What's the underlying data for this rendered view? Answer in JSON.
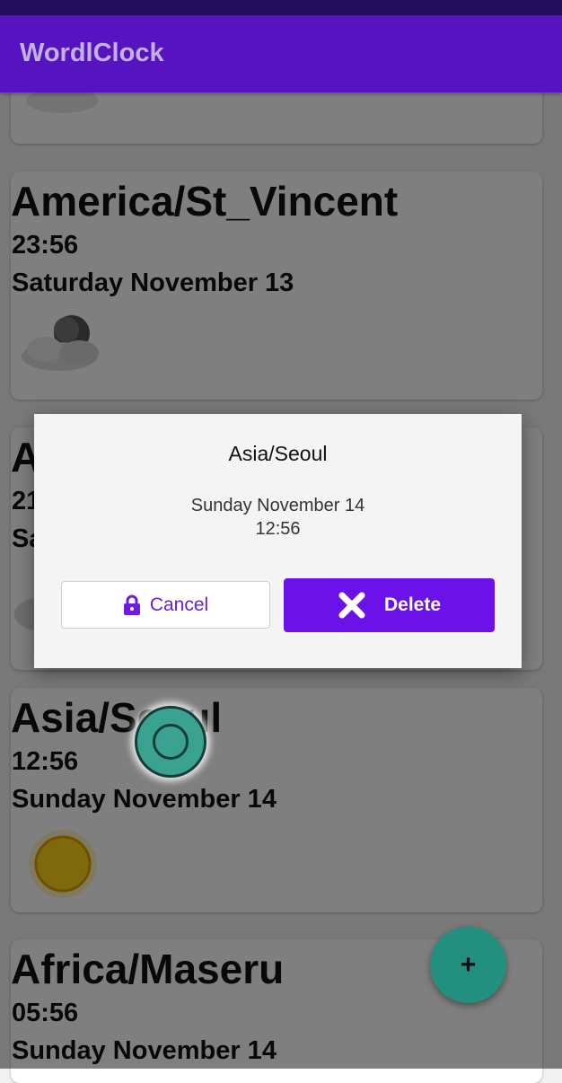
{
  "app": {
    "title": "WordlClock"
  },
  "cards": [
    {
      "zone": "",
      "time": "",
      "date": "",
      "weather_icon": "cloud-icon"
    },
    {
      "zone": "America/St_Vincent",
      "time": "23:56",
      "date": "Saturday November 13",
      "weather_icon": "night-cloud-icon"
    },
    {
      "zone": "A",
      "time": "21",
      "date": "Sa",
      "weather_icon": "cloud-icon"
    },
    {
      "zone": "Asia/Seoul",
      "time": "12:56",
      "date": "Sunday November 14",
      "weather_icon": "sun-icon"
    },
    {
      "zone": "Africa/Maseru",
      "time": "05:56",
      "date": "Sunday November 14",
      "weather_icon": ""
    }
  ],
  "dialog": {
    "title": "Asia/Seoul",
    "date": "Sunday November 14",
    "time": "12:56",
    "cancel_label": "Cancel",
    "cancel_icon": "lock-icon",
    "delete_label": "Delete",
    "delete_icon": "close-icon"
  },
  "fab": {
    "label": "+",
    "icon": "plus-icon"
  },
  "colors": {
    "primary": "#5614c0",
    "accent": "#6b12e8",
    "fab": "#23907f"
  }
}
